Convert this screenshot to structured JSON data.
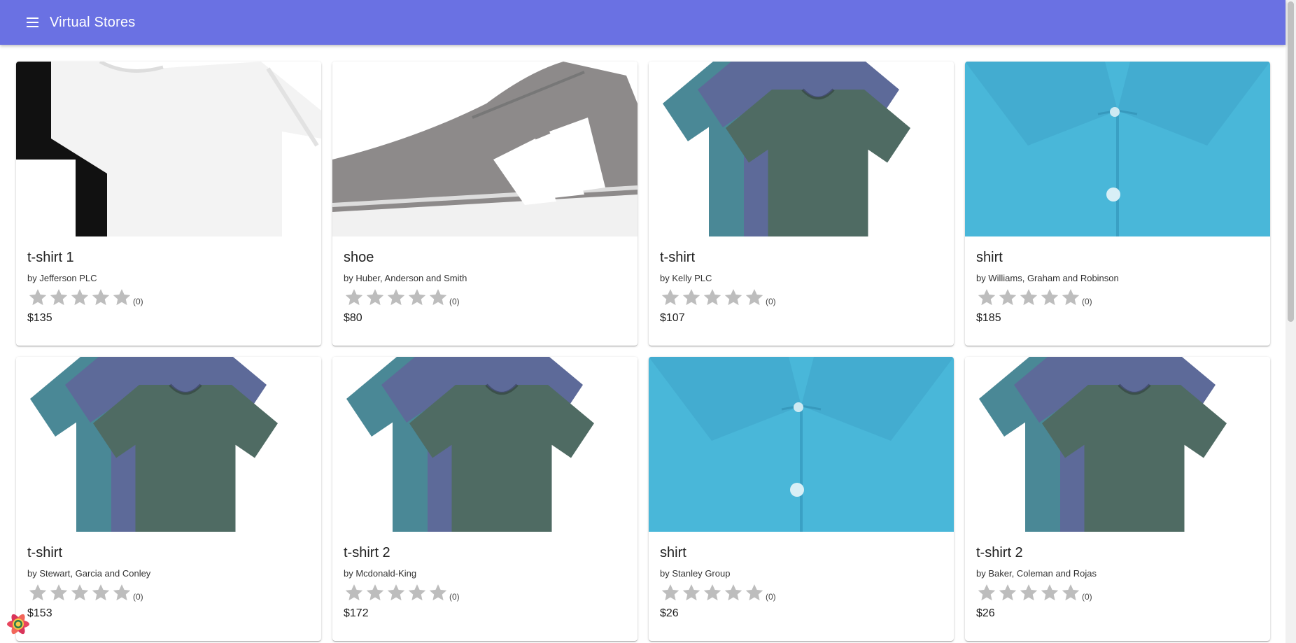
{
  "app": {
    "title": "Virtual Stores"
  },
  "colors": {
    "appbar": "#6a71e3",
    "star_empty": "#bdbdbd",
    "shirt_blue": "#49b7d9"
  },
  "products": [
    {
      "title": "t-shirt 1",
      "by": "by Jefferson PLC",
      "rating_count": "(0)",
      "price": "$135",
      "image": "white-tshirt"
    },
    {
      "title": "shoe",
      "by": "by Huber, Anderson and Smith",
      "rating_count": "(0)",
      "price": "$80",
      "image": "gray-sneaker"
    },
    {
      "title": "t-shirt",
      "by": "by Kelly PLC",
      "rating_count": "(0)",
      "price": "$107",
      "image": "tshirt-stack"
    },
    {
      "title": "shirt",
      "by": "by Williams, Graham and Robinson",
      "rating_count": "(0)",
      "price": "$185",
      "image": "blue-shirt"
    },
    {
      "title": "t-shirt",
      "by": "by Stewart, Garcia and Conley",
      "rating_count": "(0)",
      "price": "$153",
      "image": "tshirt-stack"
    },
    {
      "title": "t-shirt 2",
      "by": "by Mcdonald-King",
      "rating_count": "(0)",
      "price": "$172",
      "image": "tshirt-stack"
    },
    {
      "title": "shirt",
      "by": "by Stanley Group",
      "rating_count": "(0)",
      "price": "$26",
      "image": "blue-shirt"
    },
    {
      "title": "t-shirt 2",
      "by": "by Baker, Coleman and Rojas",
      "rating_count": "(0)",
      "price": "$26",
      "image": "tshirt-stack"
    }
  ]
}
